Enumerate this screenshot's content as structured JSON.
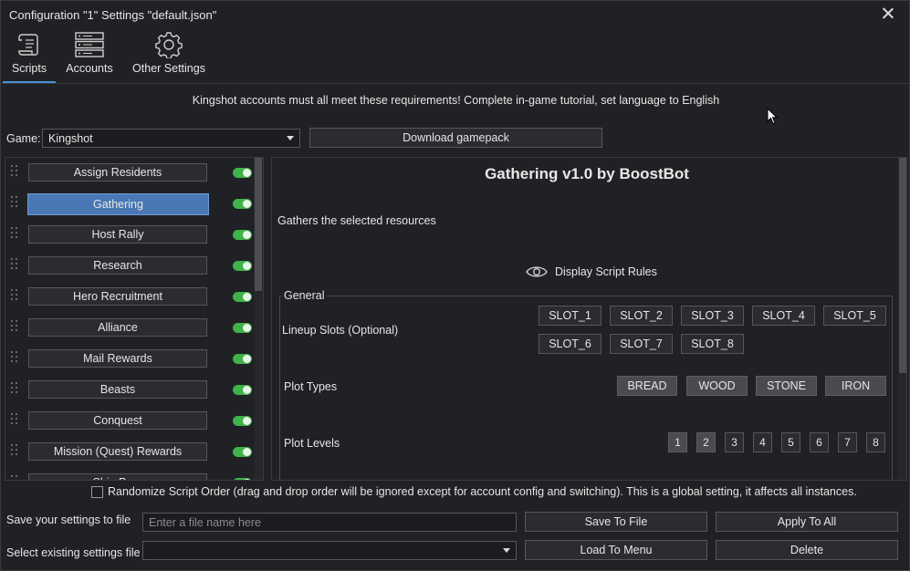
{
  "window": {
    "title": "Configuration \"1\" Settings \"default.json\""
  },
  "tabs": [
    {
      "label": "Scripts",
      "icon": "scroll-icon",
      "active": true
    },
    {
      "label": "Accounts",
      "icon": "server-icon",
      "active": false
    },
    {
      "label": "Other Settings",
      "icon": "gear-icon",
      "active": false
    }
  ],
  "notice": "Kingshot accounts must all meet these requirements! Complete in-game tutorial, set language to English",
  "game": {
    "label": "Game:",
    "selected": "Kingshot"
  },
  "download_button": "Download gamepack",
  "scripts": [
    {
      "label": "Assign Residents",
      "enabled": true,
      "selected": false
    },
    {
      "label": "Gathering",
      "enabled": true,
      "selected": true
    },
    {
      "label": "Host Rally",
      "enabled": true,
      "selected": false
    },
    {
      "label": "Research",
      "enabled": true,
      "selected": false
    },
    {
      "label": "Hero Recruitment",
      "enabled": true,
      "selected": false
    },
    {
      "label": "Alliance",
      "enabled": true,
      "selected": false
    },
    {
      "label": "Mail Rewards",
      "enabled": true,
      "selected": false
    },
    {
      "label": "Beasts",
      "enabled": true,
      "selected": false
    },
    {
      "label": "Conquest",
      "enabled": true,
      "selected": false
    },
    {
      "label": "Mission (Quest) Rewards",
      "enabled": true,
      "selected": false
    },
    {
      "label": "Ship Prep",
      "enabled": true,
      "selected": false
    }
  ],
  "detail": {
    "title": "Gathering v1.0 by BoostBot",
    "description": "Gathers the selected resources",
    "rules_label": "Display Script Rules",
    "group_title": "General",
    "lineup_label": "Lineup Slots (Optional)",
    "slots": [
      "SLOT_1",
      "SLOT_2",
      "SLOT_3",
      "SLOT_4",
      "SLOT_5",
      "SLOT_6",
      "SLOT_7",
      "SLOT_8"
    ],
    "plot_types_label": "Plot Types",
    "plot_types": [
      "BREAD",
      "WOOD",
      "STONE",
      "IRON"
    ],
    "plot_levels_label": "Plot Levels",
    "plot_levels": [
      "1",
      "2",
      "3",
      "4",
      "5",
      "6",
      "7",
      "8"
    ],
    "plot_levels_selected": [
      "1",
      "2"
    ]
  },
  "randomize": {
    "label": "Randomize Script Order (drag and drop order will be ignored except for account config and switching). This is a global setting, it affects all instances.",
    "checked": false
  },
  "save": {
    "label": "Save your settings to file",
    "placeholder": "Enter a file name here",
    "save_button": "Save To File",
    "apply_button": "Apply To All"
  },
  "load": {
    "label": "Select existing settings file",
    "selected": "",
    "load_button": "Load To Menu",
    "delete_button": "Delete"
  },
  "colors": {
    "accent": "#4a78b5",
    "toggle_on": "#3fb24a",
    "background": "#202124"
  }
}
